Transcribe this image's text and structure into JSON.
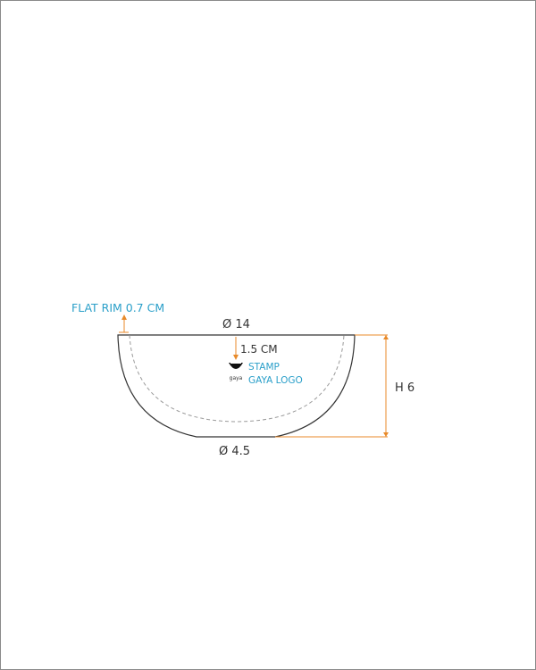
{
  "drawing": {
    "rim_label": "FLAT RIM 0.7 CM",
    "top_diameter": "Ø 14",
    "stamp_depth": "1.5 CM",
    "stamp_label": "STAMP",
    "logo_label": "GAYA LOGO",
    "logo_text": "gaya",
    "height_label": "H 6",
    "base_diameter": "Ø 4.5"
  },
  "colors": {
    "dimension_line": "#e88a2a",
    "annotation_text": "#2a9fc9",
    "outline": "#333333"
  }
}
